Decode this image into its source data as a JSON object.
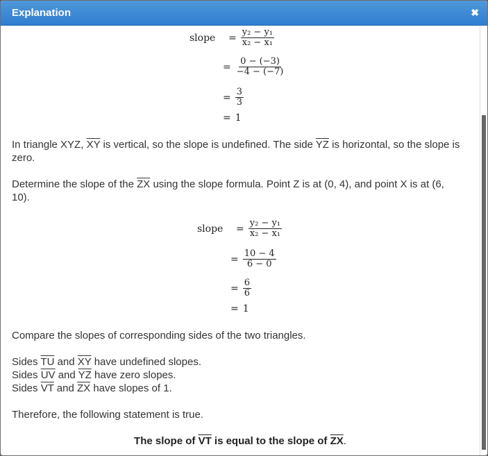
{
  "dialog": {
    "title": "Explanation",
    "close_icon": "close-x-icon"
  },
  "math1": {
    "label": "slope",
    "formula_num": "y₂ − y₁",
    "formula_den": "x₂ − x₁",
    "step1_num": "0 − (−3)",
    "step1_den": "−4 − (−7)",
    "step2_num": "3",
    "step2_den": "3",
    "result": "1",
    "eq": "="
  },
  "para1": {
    "t1": "In triangle XYZ, ",
    "s1": "XY",
    "t2": " is vertical, so the slope is undefined. The side ",
    "s2": "YZ",
    "t3": " is horizontal, so the slope is zero."
  },
  "para2": {
    "t1": "Determine the slope of the ",
    "s1": "ZX",
    "t2": " using the slope formula. Point Z is at (0, 4), and point X is at (6, 10)."
  },
  "math2": {
    "label": "slope",
    "formula_num": "y₂ − y₁",
    "formula_den": "x₂ − x₁",
    "step1_num": "10 − 4",
    "step1_den": "6 − 0",
    "step2_num": "6",
    "step2_den": "6",
    "result": "1",
    "eq": "="
  },
  "para3": "Compare the slopes of corresponding sides of the two triangles.",
  "sides": [
    {
      "pre": "Sides ",
      "a": "TU",
      "mid": " and ",
      "b": "XY",
      "post": " have undefined slopes."
    },
    {
      "pre": "Sides ",
      "a": "UV",
      "mid": " and ",
      "b": "YZ",
      "post": " have zero slopes."
    },
    {
      "pre": "Sides ",
      "a": "VT",
      "mid": " and ",
      "b": "ZX",
      "post": " have slopes of 1."
    }
  ],
  "para4": "Therefore, the following statement is true.",
  "conclusion": {
    "t1": "The slope of ",
    "s1": "VT",
    "t2": " is equal to the slope of ",
    "s2": "ZX",
    "t3": "."
  }
}
